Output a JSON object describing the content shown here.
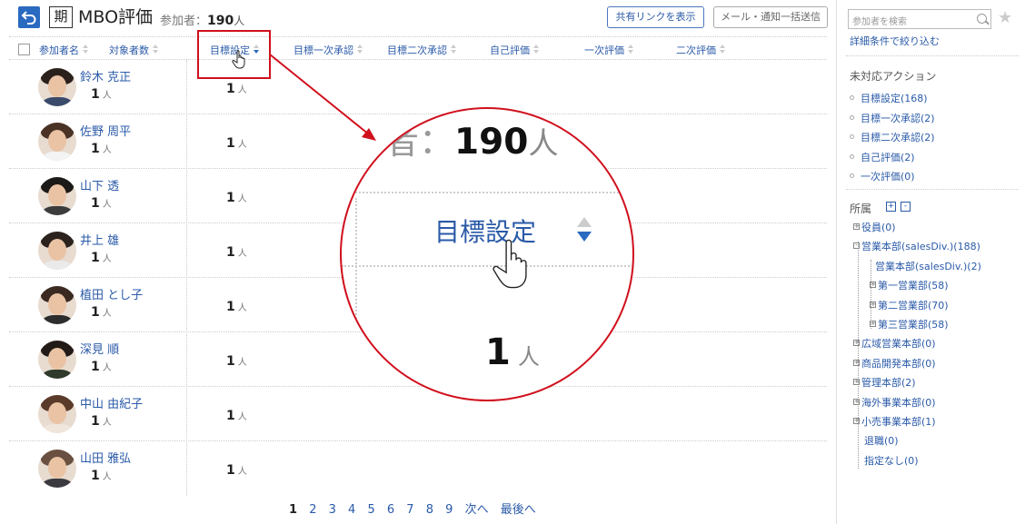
{
  "header": {
    "period_label": "期",
    "title": "MBO評価",
    "participants_label": "参加者：",
    "participants_count": "190",
    "participants_unit": "人",
    "share_button": "共有リンクを表示",
    "mail_button": "メール・通知一括送信"
  },
  "columns": {
    "name": "参加者名",
    "target_count": "対象者数",
    "goal_setting": "目標設定",
    "goal_first_approval": "目標一次承認",
    "goal_second_approval": "目標二次承認",
    "self_eval": "自己評価",
    "first_eval": "一次評価",
    "second_eval": "二次評価"
  },
  "rows": [
    {
      "name": "鈴木 克正",
      "count": "1",
      "unit": "人",
      "goal": "1",
      "goal_unit": "人"
    },
    {
      "name": "佐野 周平",
      "count": "1",
      "unit": "人",
      "goal": "1",
      "goal_unit": "人"
    },
    {
      "name": "山下 透",
      "count": "1",
      "unit": "人",
      "goal": "1",
      "goal_unit": "人"
    },
    {
      "name": "井上 雄",
      "count": "1",
      "unit": "人",
      "goal": "1",
      "goal_unit": "人"
    },
    {
      "name": "植田 とし子",
      "count": "1",
      "unit": "人",
      "goal": "1",
      "goal_unit": "人"
    },
    {
      "name": "深見 順",
      "count": "1",
      "unit": "人",
      "goal": "1",
      "goal_unit": "人"
    },
    {
      "name": "中山 由紀子",
      "count": "1",
      "unit": "人",
      "goal": "1",
      "goal_unit": "人"
    },
    {
      "name": "山田 雅弘",
      "count": "1",
      "unit": "人",
      "goal": "1",
      "goal_unit": "人"
    }
  ],
  "pagination": {
    "pages": [
      "1",
      "2",
      "3",
      "4",
      "5",
      "6",
      "7",
      "8",
      "9"
    ],
    "current": "1",
    "next": "次へ",
    "last": "最後へ"
  },
  "zoom": {
    "prefix": "者：",
    "count": "190",
    "unit": "人",
    "column_label": "目標設定",
    "cell_count": "1",
    "cell_unit": "人"
  },
  "sidebar": {
    "search_placeholder": "参加者を検索",
    "filter_link": "詳細条件で絞り込む",
    "pending_title": "未対応アクション",
    "pending_actions": [
      "目標設定(168)",
      "目標一次承認(2)",
      "目標二次承認(2)",
      "自己評価(2)",
      "一次評価(0)"
    ],
    "org_title": "所属",
    "org_tree": [
      "役員(0)",
      "営業本部(salesDiv.)(188)",
      "営業本部(salesDiv.)(2)",
      "第一営業部(58)",
      "第二営業部(70)",
      "第三営業部(58)",
      "広域営業本部(0)",
      "商品開発本部(0)",
      "管理本部(2)",
      "海外事業本部(0)",
      "小売事業本部(1)",
      "退職(0)",
      "指定なし(0)"
    ]
  },
  "colors": {
    "accent_blue": "#2a5aa8",
    "highlight_red": "#d0101d"
  }
}
